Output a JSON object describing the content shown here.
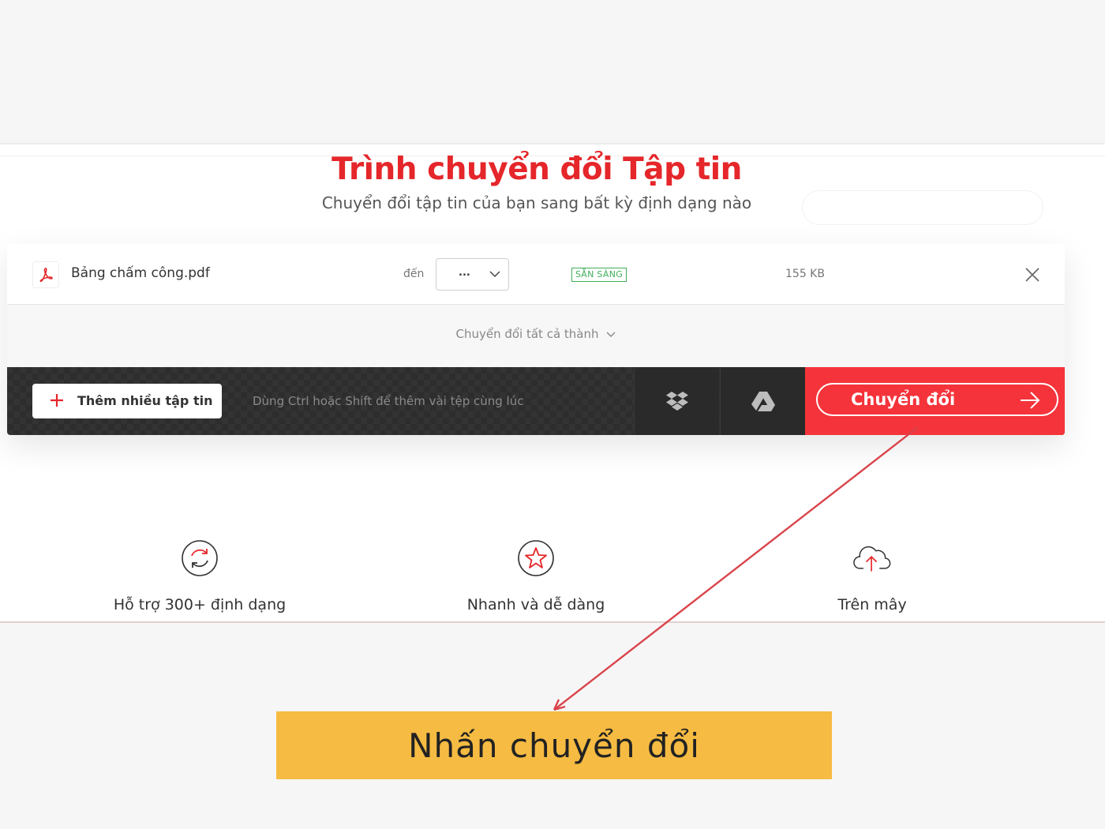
{
  "header": {
    "title": "Trình chuyển đổi Tập tin",
    "subtitle": "Chuyển đổi tập tin của bạn sang bất kỳ định dạng nào"
  },
  "file": {
    "name": "Bảng chấm công.pdf",
    "to_label": "đến",
    "format_value": "...",
    "status": "SẴN SÀNG",
    "size": "155 KB"
  },
  "convert_all_label": "Chuyển đổi tất cả thành",
  "actions": {
    "add_label": "Thêm nhiều tập tin",
    "hint": "Dùng Ctrl hoặc Shift để thêm vài tệp cùng lúc",
    "convert_label": "Chuyển đổi"
  },
  "features": [
    {
      "label": "Hỗ trợ 300+ định dạng",
      "icon": "refresh-icon"
    },
    {
      "label": "Nhanh và dễ dàng",
      "icon": "star-icon"
    },
    {
      "label": "Trên mây",
      "icon": "cloud-upload-icon"
    }
  ],
  "annotation": {
    "callout_text": "Nhấn chuyển đổi",
    "arrow_color": "#d9434a",
    "callout_color": "#f6bb42"
  },
  "colors": {
    "brand_red": "#e5262a",
    "convert_red": "#f5333a",
    "ready_green": "#3fae5a"
  }
}
